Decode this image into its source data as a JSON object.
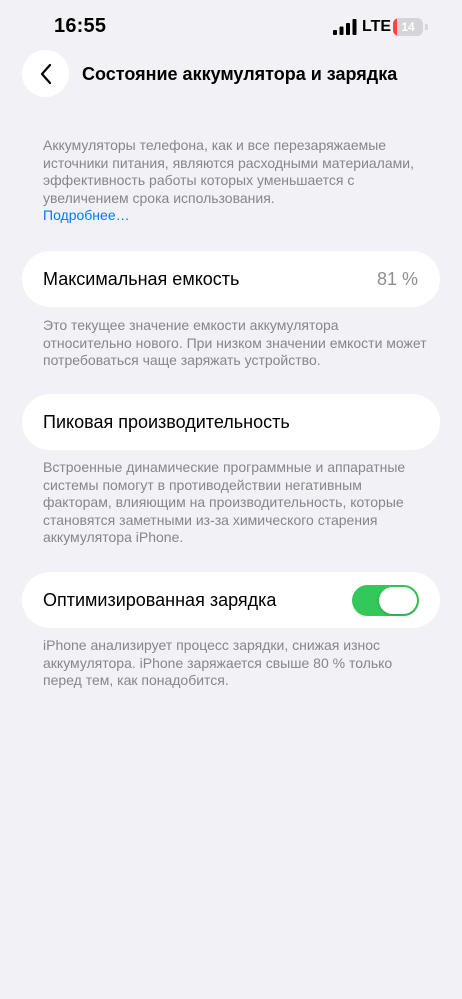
{
  "status_bar": {
    "time": "16:55",
    "network": "LTE",
    "battery_level": "14",
    "battery_fraction": 0.14,
    "battery_color": "#ff453a"
  },
  "nav": {
    "title": "Состояние аккумулятора и зарядка",
    "back_icon": "chevron-left-icon"
  },
  "intro": {
    "text": "Аккумуляторы телефона, как и все перезаряжаемые источники питания, являются расходными материалами, эффективность работы которых уменьшается с увеличением срока использования.",
    "link": "Подробнее…"
  },
  "max_capacity": {
    "label": "Максимальная емкость",
    "value": "81 %",
    "footnote": "Это текущее значение емкости аккумулятора относительно нового. При низком значении емкости может потребоваться чаще заряжать устройство."
  },
  "peak_performance": {
    "label": "Пиковая производительность",
    "footnote": "Встроенные динамические программные и аппаратные системы помогут в противодействии негативным факторам, влияющим на производительность, которые становятся заметными из-за химического старения аккумулятора iPhone."
  },
  "optimized_charging": {
    "label": "Оптимизированная зарядка",
    "enabled": true,
    "toggle_color": "#34c759",
    "footnote": "iPhone анализирует процесс зарядки, снижая износ аккумулятора. iPhone заряжается свыше 80 % только перед тем, как понадобится."
  }
}
